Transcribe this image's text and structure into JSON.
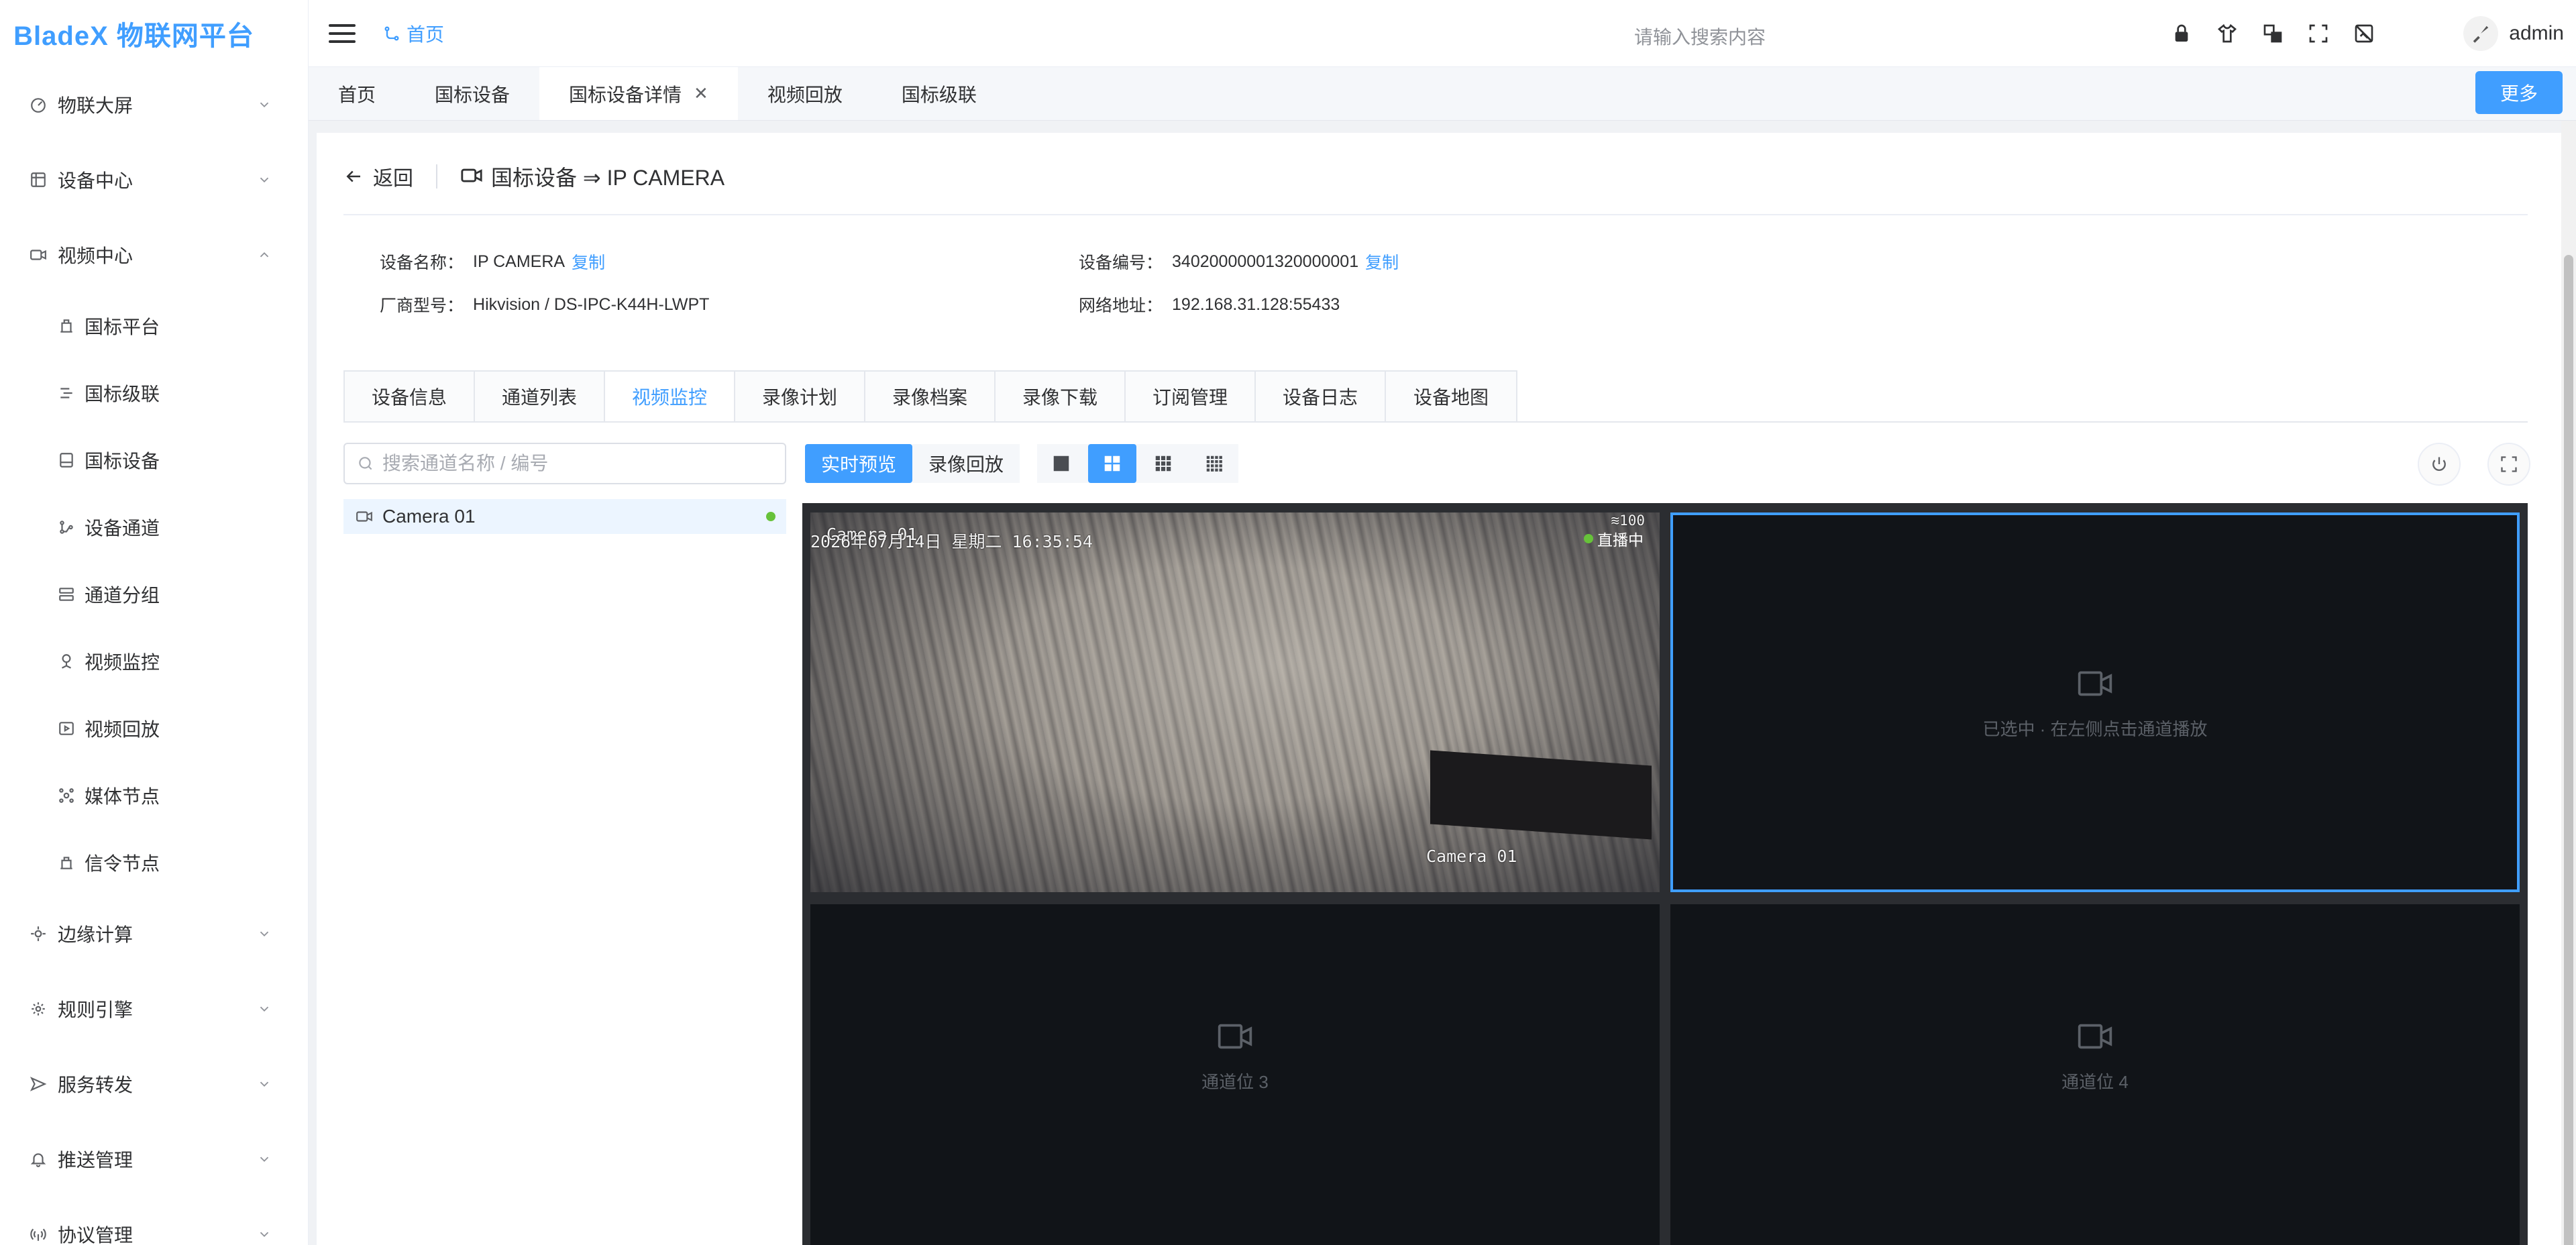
{
  "app": {
    "logo": "BladeX 物联网平台"
  },
  "header": {
    "breadcrumb": "首页",
    "search_placeholder": "请输入搜索内容",
    "icons": [
      "lock-icon",
      "shirt-icon",
      "translate-icon",
      "fullscreen-icon",
      "image-icon"
    ],
    "user": "admin"
  },
  "sidebar": {
    "items": [
      {
        "label": "物联大屏",
        "icon": "dashboard-icon",
        "expanded": false
      },
      {
        "label": "设备中心",
        "icon": "device-icon",
        "expanded": false
      },
      {
        "label": "视频中心",
        "icon": "video-icon",
        "expanded": true
      }
    ],
    "video_children": [
      {
        "label": "国标平台",
        "icon": "platform-icon"
      },
      {
        "label": "国标级联",
        "icon": "cascade-icon"
      },
      {
        "label": "国标设备",
        "icon": "gb-device-icon"
      },
      {
        "label": "设备通道",
        "icon": "channel-icon"
      },
      {
        "label": "通道分组",
        "icon": "group-icon"
      },
      {
        "label": "视频监控",
        "icon": "monitor-icon"
      },
      {
        "label": "视频回放",
        "icon": "playback-icon"
      },
      {
        "label": "媒体节点",
        "icon": "media-node-icon"
      },
      {
        "label": "信令节点",
        "icon": "signal-node-icon"
      }
    ],
    "rest": [
      {
        "label": "边缘计算",
        "icon": "edge-icon"
      },
      {
        "label": "规则引擎",
        "icon": "rule-icon"
      },
      {
        "label": "服务转发",
        "icon": "forward-icon"
      },
      {
        "label": "推送管理",
        "icon": "bell-icon"
      },
      {
        "label": "协议管理",
        "icon": "protocol-icon"
      }
    ]
  },
  "tags": {
    "items": [
      "首页",
      "国标设备",
      "国标设备详情",
      "视频回放",
      "国标级联"
    ],
    "active_index": 2,
    "more": "更多"
  },
  "page": {
    "back": "返回",
    "title": "国标设备 ⇒ IP CAMERA"
  },
  "device": {
    "name_label": "设备名称：",
    "name": "IP CAMERA",
    "code_label": "设备编号：",
    "code": "34020000001320000001",
    "vendor_label": "厂商型号：",
    "vendor": "Hikvision / DS-IPC-K44H-LWPT",
    "addr_label": "网络地址：",
    "addr": "192.168.31.128:55433",
    "copy": "复制"
  },
  "detail_tabs": {
    "items": [
      "设备信息",
      "通道列表",
      "视频监控",
      "录像计划",
      "录像档案",
      "录像下载",
      "订阅管理",
      "设备日志",
      "设备地图"
    ],
    "active_index": 2
  },
  "monitor": {
    "search_placeholder": "搜索通道名称 / 编号",
    "channels": [
      {
        "name": "Camera 01",
        "online": true
      }
    ],
    "mode_live": "实时预览",
    "mode_playback": "录像回放",
    "layouts": [
      "1x1",
      "2x2",
      "3x3",
      "4x4"
    ],
    "active_layout": "2x2",
    "cells": {
      "cam_title": "Camera 01",
      "cam_datetime": "2026年07月14日  星期二  16:35:54",
      "cam_signal": "100",
      "live_label": "直播中",
      "cam_bottom_label": "Camera 01",
      "selected_hint": "已选中 · 在左侧点击通道播放",
      "slot3": "通道位 3",
      "slot4": "通道位 4"
    }
  },
  "colors": {
    "primary": "#409eff",
    "online": "#67c23a"
  }
}
